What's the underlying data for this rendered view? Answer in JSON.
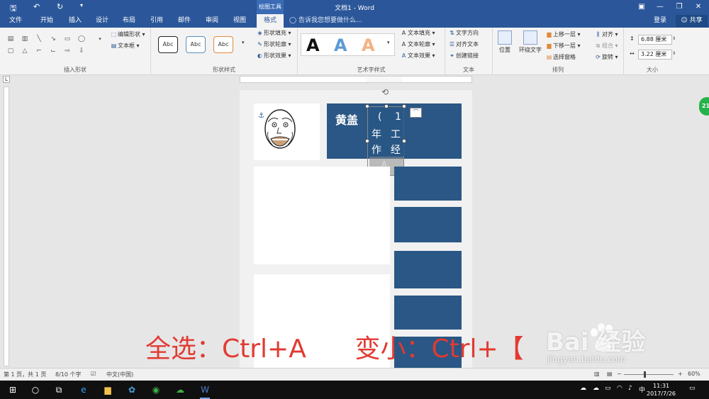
{
  "titlebar": {
    "title": "文档1 - Word",
    "context_tab": "绘图工具",
    "save_glyph": "🖫",
    "undo_glyph": "↶",
    "redo_glyph": "↻",
    "customize_glyph": "▾",
    "ribbon_options_glyph": "▣",
    "minimize_glyph": "—",
    "restore_glyph": "❐",
    "close_glyph": "✕"
  },
  "tabs": [
    {
      "label": "文件"
    },
    {
      "label": "开始"
    },
    {
      "label": "插入"
    },
    {
      "label": "设计"
    },
    {
      "label": "布局"
    },
    {
      "label": "引用"
    },
    {
      "label": "邮件"
    },
    {
      "label": "审阅"
    },
    {
      "label": "视图"
    },
    {
      "label": "格式"
    }
  ],
  "tell_me": "告诉我您想要做什么...",
  "login_label": "登录",
  "share_label": "共享",
  "ribbon": {
    "insert_shapes": {
      "label": "插入形状",
      "edit_shape": "编辑形状",
      "text_box": "文本框"
    },
    "shape_styles": {
      "label": "形状样式",
      "sample": "Abc",
      "fill": "形状填充",
      "outline": "形状轮廓",
      "effects": "形状效果"
    },
    "art_styles": {
      "label": "艺术字样式",
      "letter": "A",
      "text_fill": "文本填充",
      "text_outline": "文本轮廓",
      "text_effects": "文本效果"
    },
    "text": {
      "label": "文本",
      "direction": "文字方向",
      "align": "对齐文本",
      "link": "创建链接"
    },
    "arrange": {
      "label": "排列",
      "position": "位置",
      "wrap": "环绕文字",
      "bring_forward": "上移一层",
      "send_backward": "下移一层",
      "selection_pane": "选择窗格",
      "align": "对齐",
      "group": "组合",
      "rotate": "旋转"
    },
    "size": {
      "label": "大小",
      "height": "6.88 厘米",
      "width": "3.22 厘米"
    }
  },
  "document": {
    "name": "黄盖",
    "textbox_chars": [
      "(",
      "1",
      "年",
      "工",
      "作",
      "经"
    ],
    "overflow_char": "A"
  },
  "caption": "全选：Ctrl+A      变小：Ctrl+【",
  "watermark": {
    "brand": "Bai  经验",
    "url": "jingyan.baidu.com"
  },
  "side_badge": "21",
  "statusbar": {
    "page": "第 1 页，共 1 页",
    "words": "8/10 个字",
    "language": "中文(中国)",
    "zoom": "60%",
    "zoom_minus": "−",
    "zoom_plus": "+"
  },
  "taskbar": {
    "time": "11:31",
    "date": "2017/7/26",
    "ime": "中"
  },
  "colors": {
    "word_blue": "#2b579a",
    "block_blue": "#2a5785",
    "caption_red": "#e23a32"
  }
}
